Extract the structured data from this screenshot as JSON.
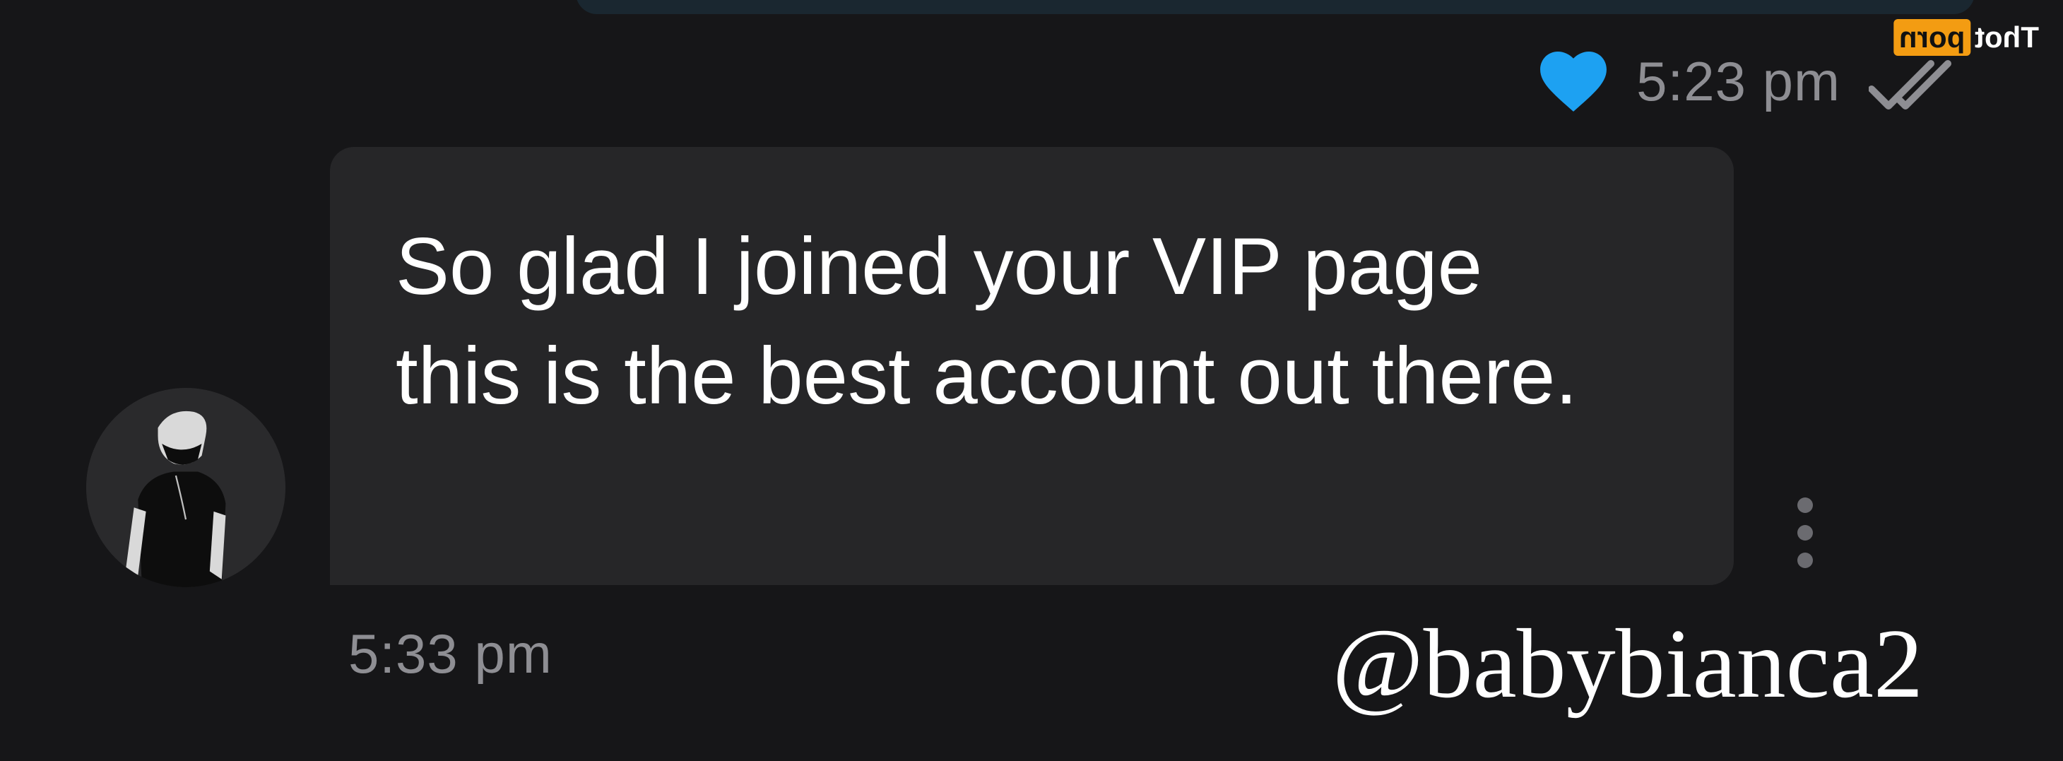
{
  "sent_message": {
    "time": "5:23 pm",
    "reaction_icon": "heart-icon",
    "reaction_color": "#1da1f2",
    "status_icon": "double-check-icon"
  },
  "received_message": {
    "text": "So glad I joined your VIP page this is the best account out there.",
    "time": "5:33 pm",
    "avatar_icon": "masked-person-avatar",
    "options_icon": "kebab-menu-icon"
  },
  "watermarks": {
    "brand": {
      "text": "Thot",
      "badge": "porn",
      "badge_color": "#f39c12"
    },
    "handle": "@babybianca2"
  },
  "colors": {
    "background": "#161618",
    "bubble": "#262628",
    "meta_text": "#8e8e93"
  }
}
